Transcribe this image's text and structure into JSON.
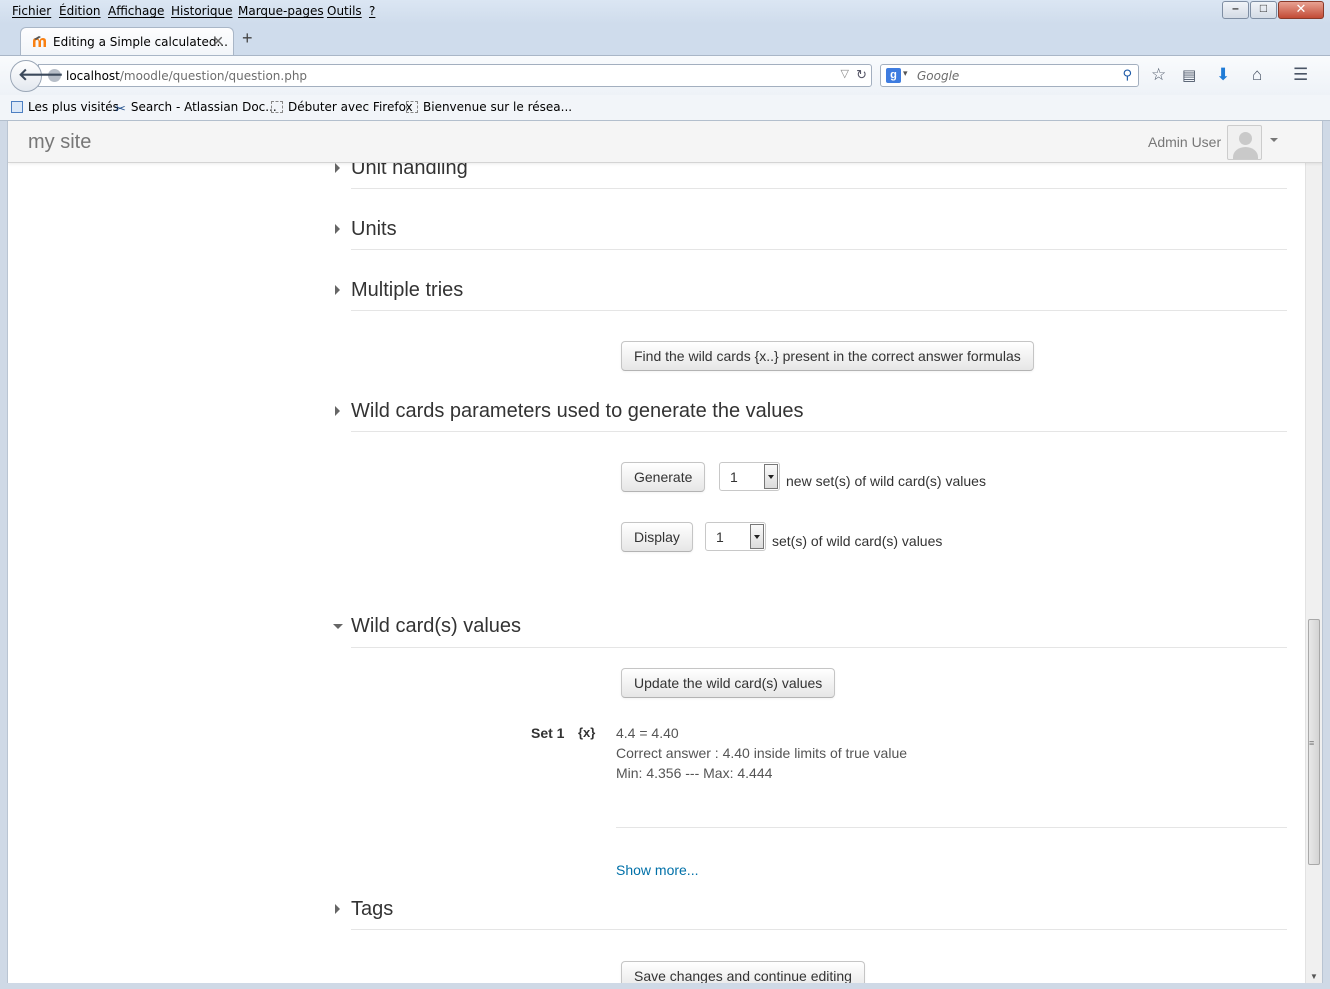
{
  "browser": {
    "menu": [
      "Fichier",
      "Édition",
      "Affichage",
      "Historique",
      "Marque-pages",
      "Outils",
      "?"
    ],
    "tab_title": "Editing a Simple calculated...",
    "url_host": "localhost",
    "url_path": "/moodle/question/question.php",
    "search_placeholder": "Google",
    "bookmarks": [
      "Les plus visités",
      "Search - Atlassian Doc...",
      "Débuter avec Firefox",
      "Bienvenue sur le résea..."
    ]
  },
  "site": {
    "brand": "my site",
    "user_name": "Admin User"
  },
  "sections": {
    "unit_handling": "Unit handling",
    "units": "Units",
    "multiple_tries": "Multiple tries",
    "wild_params": "Wild cards parameters used to generate the values",
    "wild_values": "Wild card(s) values",
    "tags": "Tags"
  },
  "buttons": {
    "find_wildcards": "Find the wild cards {x..} present in the correct answer formulas",
    "generate": "Generate",
    "display": "Display",
    "update_values": "Update the wild card(s) values",
    "save_continue": "Save changes and continue editing"
  },
  "generate_row": {
    "value": "1",
    "suffix": "new set(s) of wild card(s) values"
  },
  "display_row": {
    "value": "1",
    "suffix": "set(s) of wild card(s) values"
  },
  "set1": {
    "label": "Set 1",
    "var": "{x}",
    "value_line": "4.4 = 4.40",
    "correct_line": "Correct answer : 4.40 inside limits of true value",
    "minmax_line": "Min: 4.356 --- Max: 4.444"
  },
  "show_more": "Show more..."
}
